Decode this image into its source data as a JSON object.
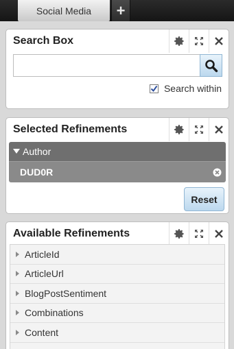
{
  "tabs": {
    "active_label": "Social Media",
    "add_label": "+"
  },
  "search_panel": {
    "title": "Search Box",
    "input_value": "",
    "search_within_label": "Search within",
    "search_within_checked": true
  },
  "selected_panel": {
    "title": "Selected Refinements",
    "group_label": "Author",
    "value_label": "DUD0R",
    "reset_label": "Reset"
  },
  "available_panel": {
    "title": "Available Refinements",
    "items": [
      {
        "label": "ArticleId"
      },
      {
        "label": "ArticleUrl"
      },
      {
        "label": "BlogPostSentiment"
      },
      {
        "label": "Combinations"
      },
      {
        "label": "Content"
      }
    ]
  },
  "icons": {
    "settings": "gear-icon",
    "expand": "expand-icon",
    "close": "close-icon",
    "search": "search-icon",
    "remove": "remove-circle-icon",
    "collapse": "triangle-down-icon",
    "expand_item": "triangle-right-icon"
  },
  "colors": {
    "button_top": "#e8f3fb",
    "button_bottom": "#bcd8ee",
    "group_header": "#6f6f6f",
    "group_value": "#8a8a8a"
  }
}
